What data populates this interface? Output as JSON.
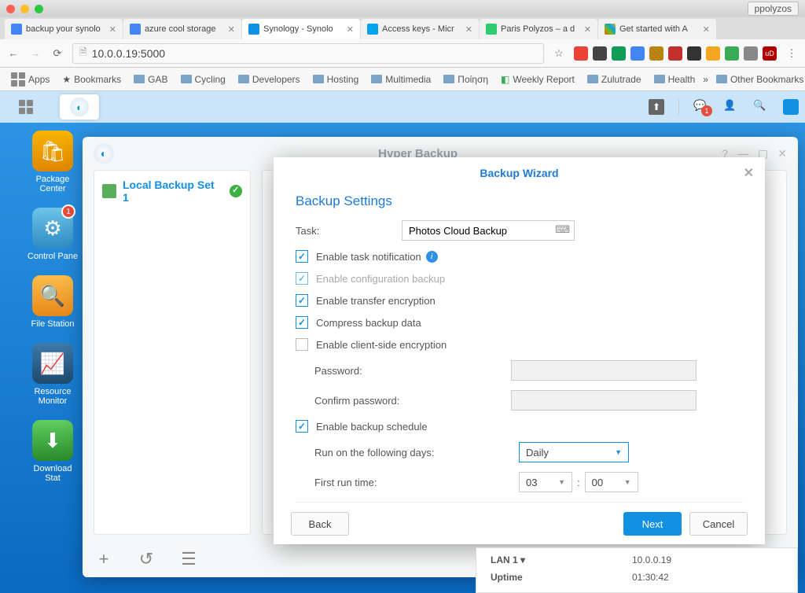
{
  "browser": {
    "profile": "ppolyzos",
    "url": "10.0.0.19:5000",
    "tabs": [
      {
        "label": "backup your synolo",
        "favicon": "#4285f4"
      },
      {
        "label": "azure cool storage",
        "favicon": "#4285f4"
      },
      {
        "label": "Synology - Synolo",
        "favicon": "#1290e2",
        "active": true
      },
      {
        "label": "Access keys - Micr",
        "favicon": "#00a4ef"
      },
      {
        "label": "Paris Polyzos – a d",
        "favicon": "#2ecc71"
      },
      {
        "label": "Get started with A",
        "favicon": "#f25022"
      }
    ],
    "bookmarks": [
      "Apps",
      "Bookmarks",
      "GAB",
      "Cycling",
      "Developers",
      "Hosting",
      "Multimedia",
      "Ποίηση",
      "Weekly Report",
      "Zulutrade",
      "Health",
      "Other Bookmarks"
    ]
  },
  "dsm": {
    "notif_badge": "1",
    "icons": [
      {
        "name": "Package Center",
        "color": "#f7b500"
      },
      {
        "name": "Control Pane",
        "color": "#3da7e0",
        "badge": "1"
      },
      {
        "name": "File Station",
        "color": "#f6a623"
      },
      {
        "name": "Resource Monitor",
        "color": "#2b5f8e"
      },
      {
        "name": "Download Stat",
        "color": "#39b54a"
      }
    ]
  },
  "hyperbackup": {
    "title": "Hyper Backup",
    "task": "Local Backup Set 1",
    "bottom_buttons": {
      "add": "+",
      "history": "↺",
      "log": "☰"
    }
  },
  "wizard": {
    "title": "Backup Wizard",
    "heading": "Backup Settings",
    "labels": {
      "task": "Task:",
      "enable_notif": "Enable task notification",
      "enable_config": "Enable configuration backup",
      "enable_encrypt": "Enable transfer encryption",
      "compress": "Compress backup data",
      "client_encrypt": "Enable client-side encryption",
      "password": "Password:",
      "confirm_pw": "Confirm password:",
      "schedule": "Enable backup schedule",
      "run_days": "Run on the following days:",
      "first_run": "First run time:"
    },
    "values": {
      "task_name": "Photos Cloud Backup",
      "frequency": "Daily",
      "hour": "03",
      "minute": "00",
      "colon": ":"
    },
    "buttons": {
      "back": "Back",
      "next": "Next",
      "cancel": "Cancel"
    }
  },
  "network": {
    "lan_label": "LAN 1 ▾",
    "lan_ip": "10.0.0.19",
    "uptime_label": "Uptime",
    "uptime_val": "01:30:42"
  }
}
